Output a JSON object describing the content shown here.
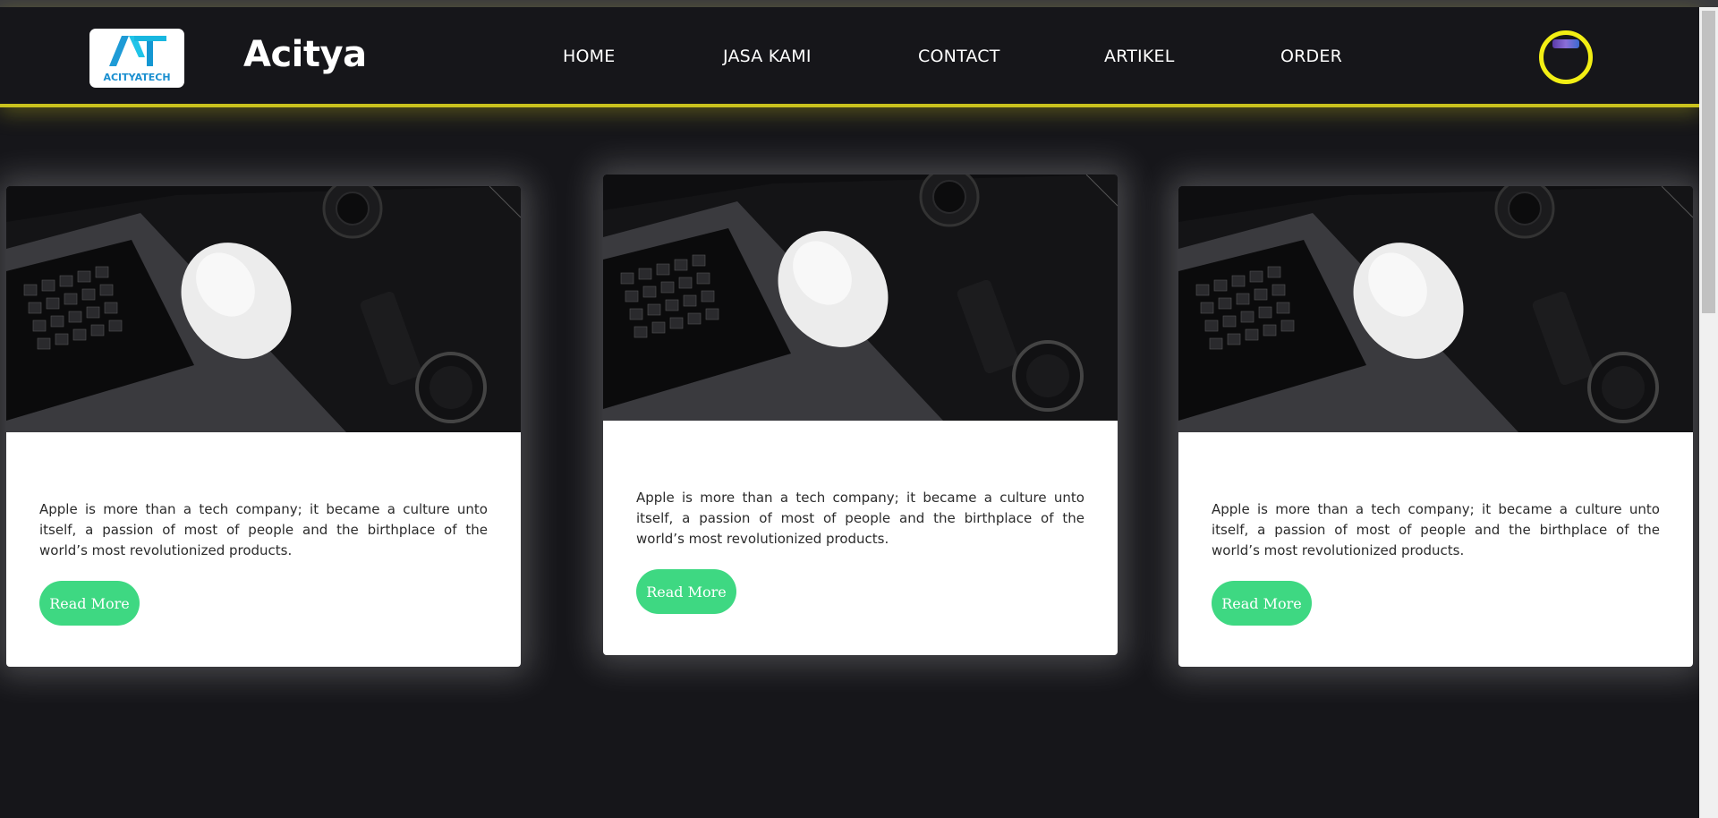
{
  "header": {
    "logo_text": "ACITYATECH",
    "brand": "Acitya",
    "nav": [
      "HOME",
      "JASA KAMI",
      "CONTACT",
      "ARTIKEL",
      "ORDER"
    ]
  },
  "cards": [
    {
      "image": "laptop-mouse-watch-photo",
      "text": "Apple is more than a tech company; it became a culture unto itself, a passion of most of people and the birthplace of the world’s most revolutionized products.",
      "button": "Read More"
    },
    {
      "image": "laptop-mouse-watch-photo",
      "text": "Apple is more than a tech company; it became a culture unto itself, a passion of most of people and the birthplace of the world’s most revolutionized products.",
      "button": "Read More"
    },
    {
      "image": "laptop-mouse-watch-photo",
      "text": "Apple is more than a tech company; it became a culture unto itself, a passion of most of people and the birthplace of the world’s most revolutionized products.",
      "button": "Read More"
    }
  ],
  "colors": {
    "background": "#16161a",
    "header_border": "#c9c21e",
    "avatar_ring": "#f2ee14",
    "button": "#3ed882",
    "card": "#ffffff"
  }
}
